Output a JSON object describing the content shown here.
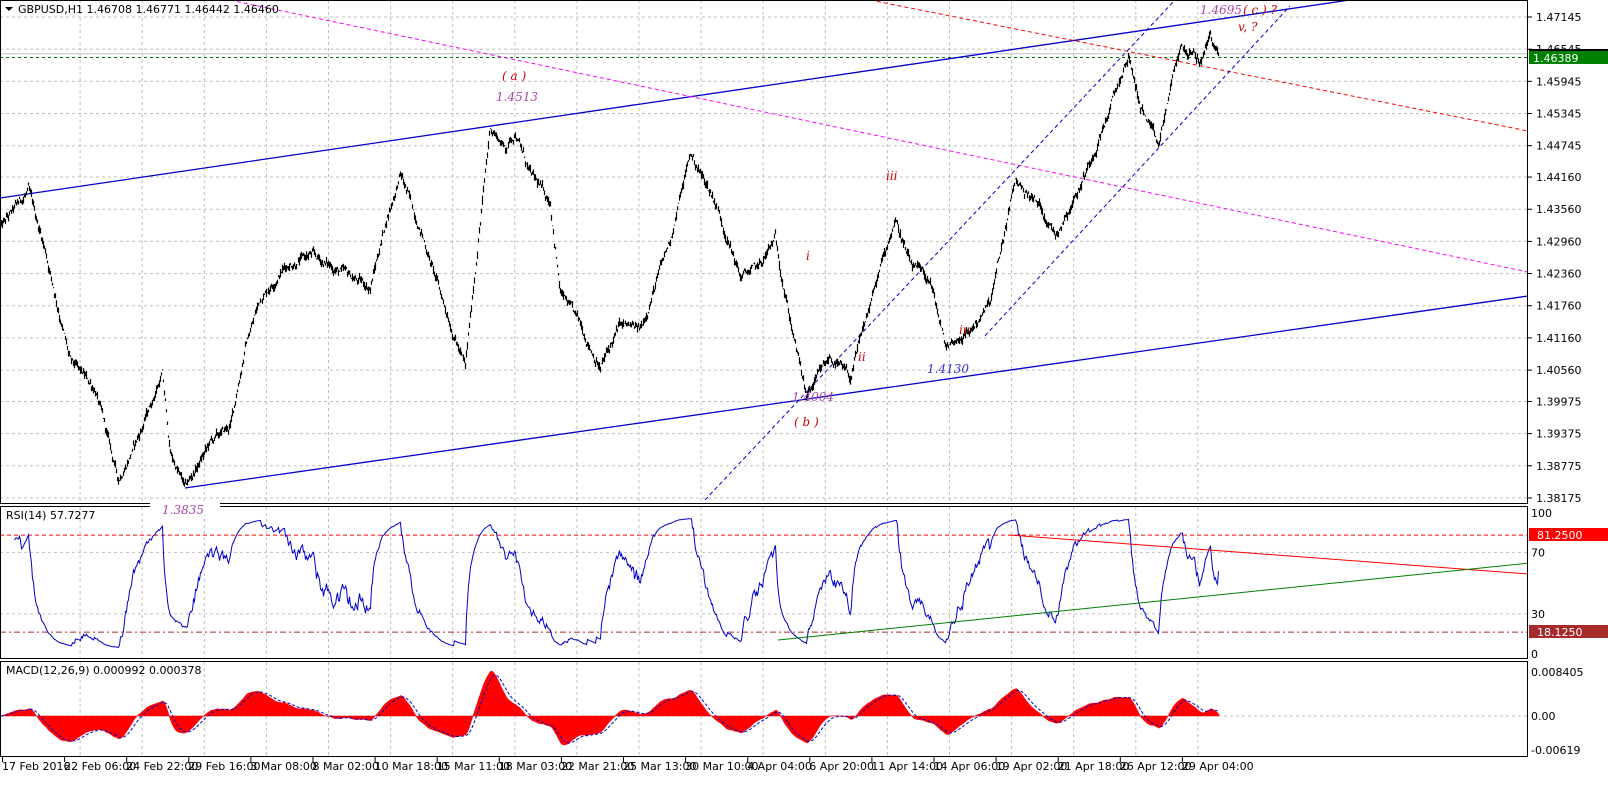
{
  "header": {
    "symbol_line": "GBPUSD,H1  1.46708 1.46771 1.46442 1.46460"
  },
  "rsi_header": "RSI(14) 57.7277",
  "macd_header": "MACD(12,26,9) 0.000992 0.000378",
  "colors": {
    "bars": "#000000",
    "channel": "#0000cc",
    "magenta": "#ff00ff",
    "red": "#ff0000",
    "green_level": "#008000",
    "rsi": "#0000cc",
    "macd_hist": "#ff0000"
  },
  "chart_data": {
    "type": "line",
    "title": "GBPUSD,H1",
    "price": {
      "open": 1.46708,
      "high": 1.46771,
      "low": 1.46442,
      "close": 1.4646,
      "ylim": [
        1.38175,
        1.47145
      ],
      "y_ticks": [
        "1.47145",
        "1.46545",
        "1.45945",
        "1.45345",
        "1.44745",
        "1.44160",
        "1.43560",
        "1.42960",
        "1.42360",
        "1.41760",
        "1.41160",
        "1.40560",
        "1.39975",
        "1.39375",
        "1.38775",
        "1.38175"
      ],
      "current_label": "1.46389",
      "level_value": 1.46389,
      "pivots": [
        [
          0,
          1.432
        ],
        [
          28,
          1.439
        ],
        [
          45,
          1.428
        ],
        [
          70,
          1.407
        ],
        [
          95,
          1.402
        ],
        [
          118,
          1.385
        ],
        [
          140,
          1.394
        ],
        [
          162,
          1.405
        ],
        [
          170,
          1.39
        ],
        [
          185,
          1.3835
        ],
        [
          210,
          1.392
        ],
        [
          230,
          1.395
        ],
        [
          245,
          1.41
        ],
        [
          260,
          1.419
        ],
        [
          285,
          1.425
        ],
        [
          310,
          1.427
        ],
        [
          340,
          1.424
        ],
        [
          370,
          1.421
        ],
        [
          385,
          1.433
        ],
        [
          400,
          1.442
        ],
        [
          420,
          1.432
        ],
        [
          440,
          1.42
        ],
        [
          465,
          1.406
        ],
        [
          478,
          1.43
        ],
        [
          490,
          1.451
        ],
        [
          505,
          1.447
        ],
        [
          515,
          1.45
        ],
        [
          530,
          1.442
        ],
        [
          550,
          1.437
        ],
        [
          560,
          1.42
        ],
        [
          580,
          1.414
        ],
        [
          600,
          1.406
        ],
        [
          620,
          1.414
        ],
        [
          640,
          1.413
        ],
        [
          670,
          1.43
        ],
        [
          690,
          1.446
        ],
        [
          715,
          1.437
        ],
        [
          740,
          1.423
        ],
        [
          760,
          1.425
        ],
        [
          775,
          1.43
        ],
        [
          790,
          1.415
        ],
        [
          806,
          1.4004
        ],
        [
          830,
          1.408
        ],
        [
          850,
          1.404
        ],
        [
          870,
          1.418
        ],
        [
          895,
          1.434
        ],
        [
          910,
          1.425
        ],
        [
          930,
          1.422
        ],
        [
          945,
          1.41
        ],
        [
          970,
          1.413
        ],
        [
          990,
          1.418
        ],
        [
          1015,
          1.441
        ],
        [
          1040,
          1.436
        ],
        [
          1055,
          1.431
        ],
        [
          1080,
          1.44
        ],
        [
          1105,
          1.452
        ],
        [
          1128,
          1.464
        ],
        [
          1140,
          1.455
        ],
        [
          1158,
          1.447
        ],
        [
          1170,
          1.458
        ],
        [
          1180,
          1.466
        ],
        [
          1200,
          1.463
        ],
        [
          1210,
          1.468
        ],
        [
          1218,
          1.4646
        ]
      ]
    },
    "drawn_lines": [
      {
        "name": "upper-channel",
        "color": "#0000cc",
        "style": "solid",
        "from": [
          0,
          1.43769
        ],
        "to": [
          1528,
          1.4795
        ]
      },
      {
        "name": "lower-channel",
        "color": "#0000cc",
        "style": "solid",
        "from": [
          185,
          1.38361
        ],
        "to": [
          1528,
          1.41942
        ]
      },
      {
        "name": "magenta-trend",
        "color": "#ff00ff",
        "style": "dash",
        "from": [
          230,
          1.47462
        ],
        "to": [
          1528,
          1.42389
        ]
      },
      {
        "name": "red-trend",
        "color": "#ff0000",
        "style": "dash",
        "from": [
          870,
          1.47462
        ],
        "to": [
          1528,
          1.45019
        ]
      },
      {
        "name": "wave-channel-upper",
        "color": "#0000cc",
        "style": "dash",
        "from": [
          705,
          1.38138
        ],
        "to": [
          1175,
          1.47462
        ]
      },
      {
        "name": "wave-channel-lower",
        "color": "#0000cc",
        "style": "dash",
        "from": [
          985,
          1.412
        ],
        "to": [
          1290,
          1.4735
        ]
      }
    ],
    "annotations": [
      {
        "text": "( a )",
        "color": "#cc0000"
      },
      {
        "text": "1.4513",
        "color": "#aa44aa"
      },
      {
        "text": "iii",
        "color": "#cc0000"
      },
      {
        "text": "i",
        "color": "#cc0000"
      },
      {
        "text": "ii",
        "color": "#cc0000"
      },
      {
        "text": "iv",
        "color": "#cc0000"
      },
      {
        "text": "1.4130",
        "color": "#3333cc"
      },
      {
        "text": "1.4004",
        "color": "#aa44aa"
      },
      {
        "text": "( b )",
        "color": "#cc0000"
      },
      {
        "text": "1.3835",
        "color": "#aa44aa"
      },
      {
        "text": "1.4695",
        "color": "#aa44aa"
      },
      {
        "text": "( c ) ?",
        "color": "#cc0000"
      },
      {
        "text": "v, ?",
        "color": "#cc0000"
      }
    ],
    "rsi": {
      "period": 14,
      "value": 57.7277,
      "ylim": [
        0,
        100
      ],
      "y_ticks": [
        "100",
        "70",
        "30",
        "0"
      ],
      "levels": [
        {
          "label": "81.2500",
          "value": 81.25,
          "color": "#ff0000"
        },
        {
          "label": "18.1250",
          "value": 18.125,
          "color": "#a52a2a"
        }
      ],
      "trendlines": [
        {
          "color": "#ff0000",
          "from": [
            1010,
            81.3
          ],
          "to": [
            1528,
            56
          ]
        },
        {
          "color": "#008000",
          "from": [
            778,
            13
          ],
          "to": [
            1528,
            63
          ]
        }
      ]
    },
    "macd": {
      "fast": 12,
      "slow": 26,
      "signal": 9,
      "main": 0.000992,
      "signal_value": 0.000378,
      "y_ticks": [
        "0.008405",
        "0.00",
        "-0.00619"
      ]
    },
    "x_ticks": [
      "17 Feb 2016",
      "22 Feb 06:00",
      "24 Feb 22:00",
      "29 Feb 16:00",
      "3 Mar 08:00",
      "8 Mar 02:00",
      "10 Mar 18:00",
      "15 Mar 11:00",
      "18 Mar 03:00",
      "22 Mar 21:00",
      "25 Mar 13:00",
      "30 Mar 10:00",
      "4 Apr 04:00",
      "6 Apr 20:00",
      "11 Apr 14:00",
      "14 Apr 06:00",
      "19 Apr 02:00",
      "21 Apr 18:00",
      "26 Apr 12:00",
      "29 Apr 04:00"
    ]
  }
}
